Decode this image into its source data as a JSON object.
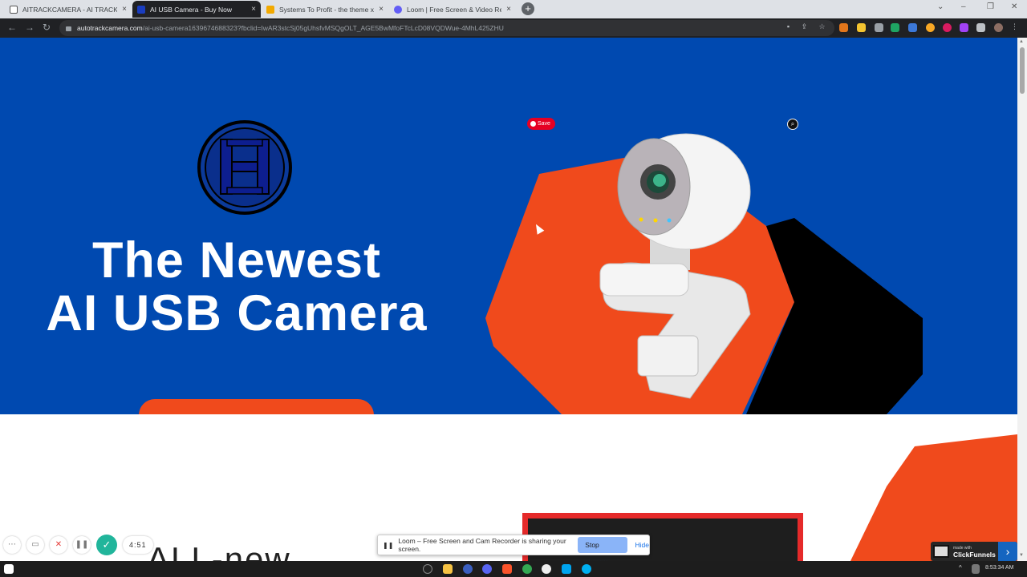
{
  "browser": {
    "tabs": [
      {
        "title": "AITRACKCAMERA - AI TRACK CA",
        "icon": "aitrack-icon",
        "active": false
      },
      {
        "title": "AI USB Camera - Buy Now",
        "icon": "funnel-icon",
        "active": true
      },
      {
        "title": "Systems To Profit - the theme x",
        "icon": "systems-icon",
        "active": false
      },
      {
        "title": "Loom | Free Screen & Video Rec",
        "icon": "loom-icon",
        "active": false
      }
    ],
    "close_glyph": "×",
    "new_tab_glyph": "+",
    "url_host": "autotrackcamera.com",
    "url_path": "/ai-usb-camera1639674688323?fbclid=IwAR3stcSj05gUhsfvMSQgOLT_AGE5BwMfoFTcLcD08VQDWue-4MhL425ZHU"
  },
  "hero": {
    "logo_letter": "H",
    "headline_line1": "The Newest",
    "headline_line2": "AI USB Camera",
    "pinterest_label": "Save",
    "colors": {
      "background": "#0049b0",
      "orange": "#f04a1c",
      "black": "#000000"
    }
  },
  "section2": {
    "heading_partial": "ALL-new"
  },
  "loom": {
    "timer": "4:51",
    "share_message": "Loom – Free Screen and Cam Recorder is sharing your screen.",
    "stop_label": "Stop sharing",
    "hide_label": "Hide"
  },
  "clickfunnels": {
    "small": "made with",
    "brand": "ClickFunnels"
  },
  "taskbar": {
    "clock": "8:53:34 AM"
  }
}
